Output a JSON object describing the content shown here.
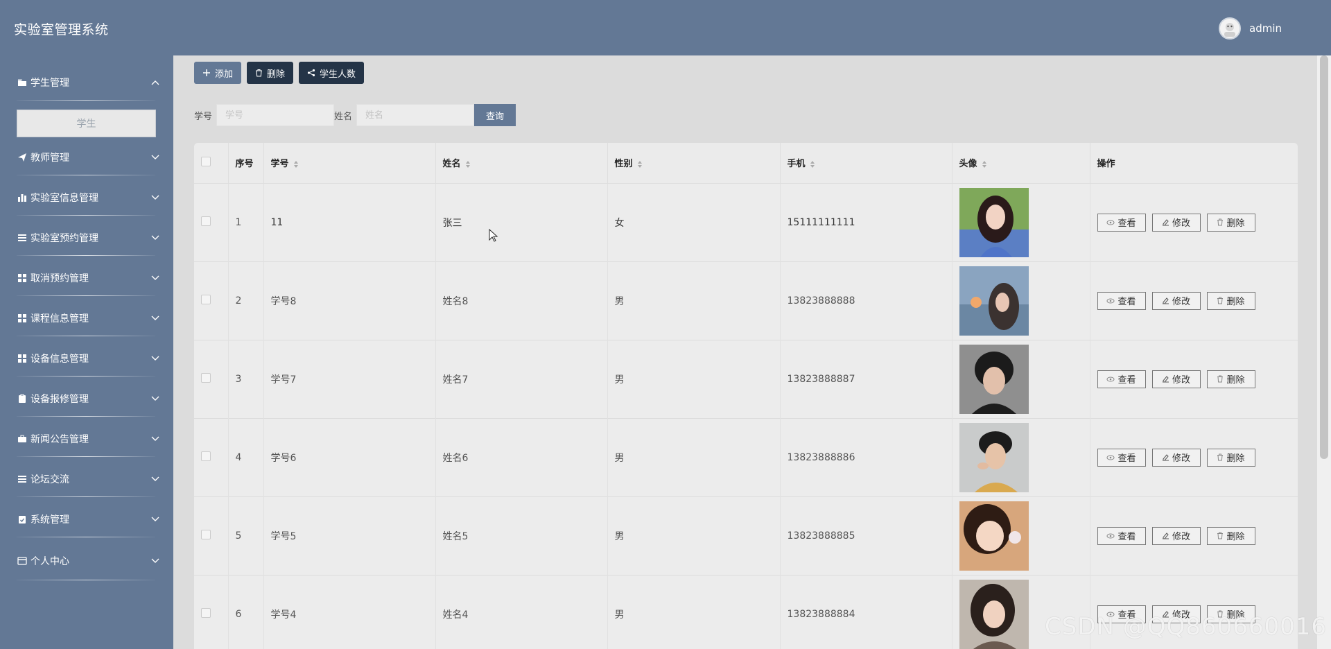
{
  "header": {
    "title": "实验室管理系统",
    "username": "admin"
  },
  "sidebar": {
    "items": [
      {
        "label": "学生管理",
        "icon": "folder-icon",
        "expanded": true
      },
      {
        "label": "教师管理",
        "icon": "send-icon"
      },
      {
        "label": "实验室信息管理",
        "icon": "bar-chart-icon"
      },
      {
        "label": "实验室预约管理",
        "icon": "list-icon"
      },
      {
        "label": "取消预约管理",
        "icon": "grid-icon"
      },
      {
        "label": "课程信息管理",
        "icon": "grid-icon"
      },
      {
        "label": "设备信息管理",
        "icon": "grid-icon"
      },
      {
        "label": "设备报修管理",
        "icon": "clipboard-icon"
      },
      {
        "label": "新闻公告管理",
        "icon": "briefcase-icon"
      },
      {
        "label": "论坛交流",
        "icon": "list-icon"
      },
      {
        "label": "系统管理",
        "icon": "clipboard-check-icon"
      },
      {
        "label": "个人中心",
        "icon": "card-icon"
      }
    ],
    "submenu": {
      "label": "学生"
    }
  },
  "toolbar": {
    "add_label": "添加",
    "delete_label": "删除",
    "count_label": "学生人数"
  },
  "search": {
    "id_label": "学号",
    "id_placeholder": "学号",
    "name_label": "姓名",
    "name_placeholder": "姓名",
    "query_label": "查询"
  },
  "table": {
    "columns": [
      "序号",
      "学号",
      "姓名",
      "性别",
      "手机",
      "头像",
      "操作"
    ],
    "rows": [
      {
        "index": "1",
        "student_id": "11",
        "name": "张三",
        "gender": "女",
        "phone": "15111111111"
      },
      {
        "index": "2",
        "student_id": "学号8",
        "name": "姓名8",
        "gender": "男",
        "phone": "13823888888"
      },
      {
        "index": "3",
        "student_id": "学号7",
        "name": "姓名7",
        "gender": "男",
        "phone": "13823888887"
      },
      {
        "index": "4",
        "student_id": "学号6",
        "name": "姓名6",
        "gender": "男",
        "phone": "13823888886"
      },
      {
        "index": "5",
        "student_id": "学号5",
        "name": "姓名5",
        "gender": "男",
        "phone": "13823888885"
      },
      {
        "index": "6",
        "student_id": "学号4",
        "name": "姓名4",
        "gender": "男",
        "phone": "13823888884"
      }
    ],
    "actions": {
      "view": "查看",
      "edit": "修改",
      "delete": "删除"
    }
  },
  "watermark": "CSDN @QQ860660016",
  "colors": {
    "primary": "#637895",
    "dark_button": "#243447",
    "background": "#dcdcdc"
  }
}
